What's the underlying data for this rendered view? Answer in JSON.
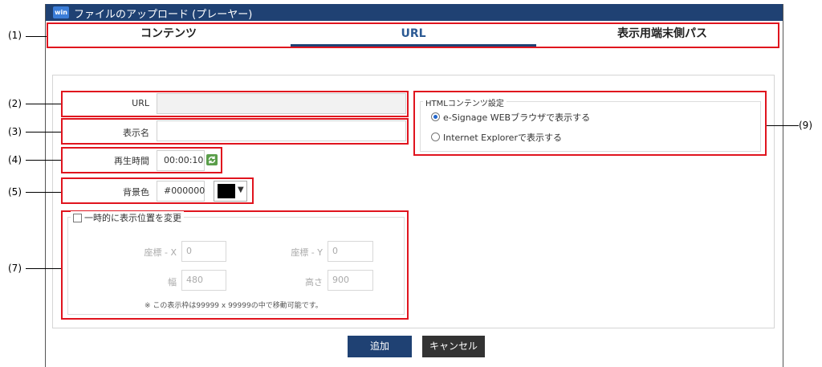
{
  "window": {
    "title": "ファイルのアップロード (プレーヤー)",
    "badge": "win"
  },
  "tabs": [
    {
      "label": "コンテンツ"
    },
    {
      "label": "URL"
    },
    {
      "label": "表示用端末側パス"
    }
  ],
  "callouts": {
    "c1": "(1)",
    "c2": "(2)",
    "c3": "(3)",
    "c4": "(4)",
    "c5": "(5)",
    "c7": "(7)",
    "c9": "(9)"
  },
  "form": {
    "url": {
      "label": "URL",
      "value": ""
    },
    "display_name": {
      "label": "表示名",
      "value": ""
    },
    "playback_time": {
      "label": "再生時間",
      "value": "00:00:10"
    },
    "bg_color": {
      "label": "背景色",
      "value": "#000000",
      "swatch": "#000000"
    },
    "position": {
      "checkbox_label": "一時的に表示位置を変更",
      "x_label": "座標 - X",
      "x_value": "0",
      "y_label": "座標 - Y",
      "y_value": "0",
      "width_label": "幅",
      "width_value": "480",
      "height_label": "高さ",
      "height_value": "900",
      "note": "※ この表示枠は99999 x 99999の中で移動可能です。"
    },
    "html_settings": {
      "legend": "HTMLコンテンツ設定",
      "options": [
        {
          "label": "e-Signage WEBブラウザで表示する",
          "selected": true
        },
        {
          "label": "Internet Explorerで表示する",
          "selected": false
        }
      ]
    }
  },
  "buttons": {
    "add": "追加",
    "cancel": "キャンセル"
  },
  "colors": {
    "titlebar": "#1f4173",
    "highlight": "#e0141e",
    "primary_button": "#1f4173",
    "cancel_button": "#333333",
    "active_tab": "#2c5a94"
  }
}
